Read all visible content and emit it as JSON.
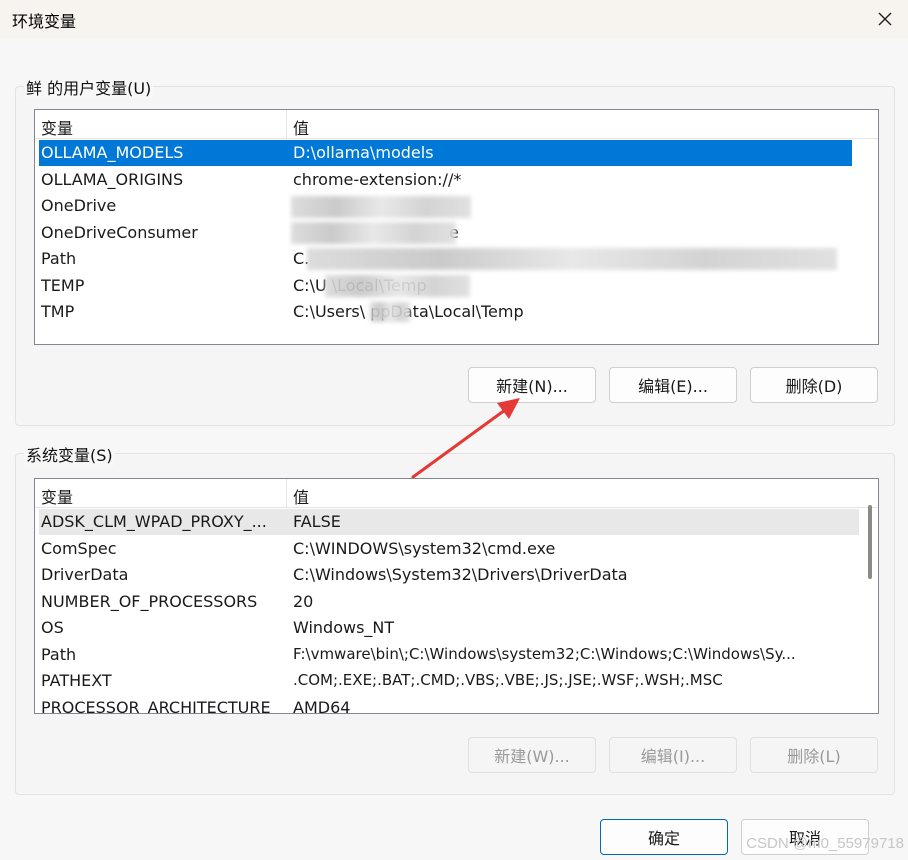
{
  "window": {
    "title": "环境变量"
  },
  "user_vars": {
    "group_title": "鲜 的用户变量(U)",
    "columns": [
      "变量",
      "值"
    ],
    "rows": [
      {
        "name": "OLLAMA_MODELS",
        "value": "D:\\ollama\\models"
      },
      {
        "name": "OLLAMA_ORIGINS",
        "value": "chrome-extension://*"
      },
      {
        "name": "OneDrive",
        "value": ""
      },
      {
        "name": "OneDriveConsumer",
        "value": "e"
      },
      {
        "name": "Path",
        "value": "C."
      },
      {
        "name": "TEMP",
        "value": "C:\\U               \\Local\\Temp"
      },
      {
        "name": "TMP",
        "value": "C:\\Users\\      ppData\\Local\\Temp"
      }
    ],
    "buttons": {
      "new": "新建(N)...",
      "edit": "编辑(E)...",
      "delete": "删除(D)"
    }
  },
  "system_vars": {
    "group_title": "系统变量(S)",
    "columns": [
      "变量",
      "值"
    ],
    "rows": [
      {
        "name": "ADSK_CLM_WPAD_PROXY_...",
        "value": "FALSE"
      },
      {
        "name": "ComSpec",
        "value": "C:\\WINDOWS\\system32\\cmd.exe"
      },
      {
        "name": "DriverData",
        "value": "C:\\Windows\\System32\\Drivers\\DriverData"
      },
      {
        "name": "NUMBER_OF_PROCESSORS",
        "value": "20"
      },
      {
        "name": "OS",
        "value": "Windows_NT"
      },
      {
        "name": "Path",
        "value": "F:\\vmware\\bin\\;C:\\Windows\\system32;C:\\Windows;C:\\Windows\\Sy..."
      },
      {
        "name": "PATHEXT",
        "value": ".COM;.EXE;.BAT;.CMD;.VBS;.VBE;.JS;.JSE;.WSF;.WSH;.MSC"
      },
      {
        "name": "PROCESSOR_ARCHITECTURE",
        "value": "AMD64"
      }
    ],
    "buttons": {
      "new": "新建(W)...",
      "edit": "编辑(I)...",
      "delete": "删除(L)"
    }
  },
  "footer": {
    "ok": "确定",
    "cancel": "取消"
  },
  "watermark": "CSDN @m0_55979718",
  "colors": {
    "selection": "#0078d7",
    "annotation_arrow": "#e53935"
  }
}
